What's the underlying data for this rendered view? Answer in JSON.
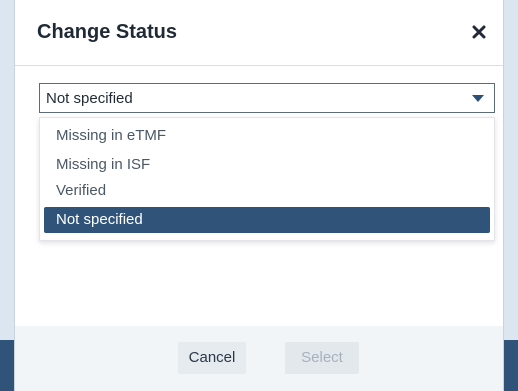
{
  "dialog": {
    "title": "Change Status",
    "close_icon": "close-icon"
  },
  "status_select": {
    "current_value": "Not specified",
    "options": [
      {
        "label": "Missing in eTMF",
        "selected": false
      },
      {
        "label": "Missing in ISF",
        "selected": false
      },
      {
        "label": "Verified",
        "selected": false
      },
      {
        "label": "Not specified",
        "selected": true
      }
    ]
  },
  "footer": {
    "cancel_label": "Cancel",
    "select_label": "Select",
    "select_enabled": false
  },
  "colors": {
    "accent": "#2f5379",
    "backdrop": "#dbe6f0",
    "footer_bg": "#f1f5f8"
  }
}
